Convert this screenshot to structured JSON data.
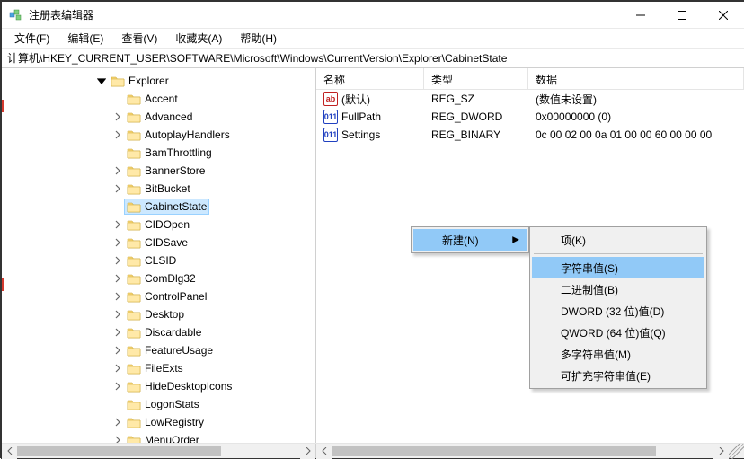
{
  "window": {
    "title": "注册表编辑器"
  },
  "menus": {
    "file": "文件(F)",
    "edit": "编辑(E)",
    "view": "查看(V)",
    "favorites": "收藏夹(A)",
    "help": "帮助(H)"
  },
  "address": "计算机\\HKEY_CURRENT_USER\\SOFTWARE\\Microsoft\\Windows\\CurrentVersion\\Explorer\\CabinetState",
  "tree": {
    "root_label": "Explorer",
    "children": [
      "Accent",
      "Advanced",
      "AutoplayHandlers",
      "BamThrottling",
      "BannerStore",
      "BitBucket",
      "CabinetState",
      "CIDOpen",
      "CIDSave",
      "CLSID",
      "ComDlg32",
      "ControlPanel",
      "Desktop",
      "Discardable",
      "FeatureUsage",
      "FileExts",
      "HideDesktopIcons",
      "LogonStats",
      "LowRegistry",
      "MenuOrder"
    ],
    "selected": "CabinetState"
  },
  "columns": {
    "name": "名称",
    "type": "类型",
    "data": "数据"
  },
  "values": [
    {
      "icon": "string",
      "name": "(默认)",
      "type": "REG_SZ",
      "data": "(数值未设置)"
    },
    {
      "icon": "binary",
      "name": "FullPath",
      "type": "REG_DWORD",
      "data": "0x00000000 (0)"
    },
    {
      "icon": "binary",
      "name": "Settings",
      "type": "REG_BINARY",
      "data": "0c 00 02 00 0a 01 00 00 60 00 00 00"
    }
  ],
  "context_menu": {
    "parent_label": "新建(N)",
    "submenu": [
      "项(K)",
      "字符串值(S)",
      "二进制值(B)",
      "DWORD (32 位)值(D)",
      "QWORD (64 位)值(Q)",
      "多字符串值(M)",
      "可扩充字符串值(E)"
    ],
    "highlighted": "字符串值(S)"
  }
}
